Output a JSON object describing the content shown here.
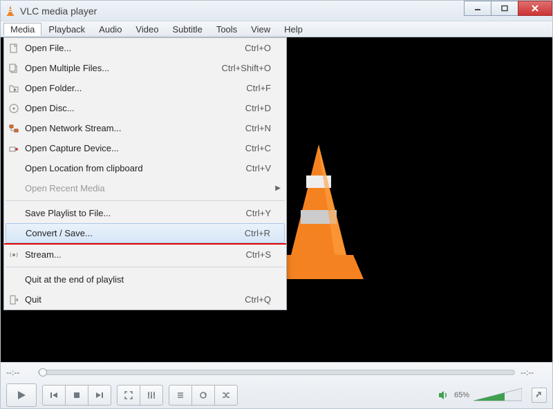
{
  "window": {
    "title": "VLC media player"
  },
  "menubar": {
    "items": [
      "Media",
      "Playback",
      "Audio",
      "Video",
      "Subtitle",
      "Tools",
      "View",
      "Help"
    ],
    "active_index": 0
  },
  "media_menu": {
    "items": [
      {
        "icon": "file-icon",
        "label": "Open File...",
        "shortcut": "Ctrl+O"
      },
      {
        "icon": "files-icon",
        "label": "Open Multiple Files...",
        "shortcut": "Ctrl+Shift+O"
      },
      {
        "icon": "folder-icon",
        "label": "Open Folder...",
        "shortcut": "Ctrl+F"
      },
      {
        "icon": "disc-icon",
        "label": "Open Disc...",
        "shortcut": "Ctrl+D"
      },
      {
        "icon": "network-icon",
        "label": "Open Network Stream...",
        "shortcut": "Ctrl+N"
      },
      {
        "icon": "capture-icon",
        "label": "Open Capture Device...",
        "shortcut": "Ctrl+C"
      },
      {
        "icon": "",
        "label": "Open Location from clipboard",
        "shortcut": "Ctrl+V"
      },
      {
        "icon": "",
        "label": "Open Recent Media",
        "shortcut": "",
        "disabled": true,
        "submenu": true
      },
      {
        "separator": true
      },
      {
        "icon": "",
        "label": "Save Playlist to File...",
        "shortcut": "Ctrl+Y"
      },
      {
        "icon": "",
        "label": "Convert / Save...",
        "shortcut": "Ctrl+R",
        "highlight": true
      },
      {
        "redline": true
      },
      {
        "icon": "stream-icon",
        "label": "Stream...",
        "shortcut": "Ctrl+S"
      },
      {
        "separator": true
      },
      {
        "icon": "",
        "label": "Quit at the end of playlist",
        "shortcut": ""
      },
      {
        "icon": "quit-icon",
        "label": "Quit",
        "shortcut": "Ctrl+Q"
      }
    ]
  },
  "progress": {
    "elapsed": "--:--",
    "total": "--:--"
  },
  "volume": {
    "percent_label": "65%",
    "level": 0.65
  }
}
